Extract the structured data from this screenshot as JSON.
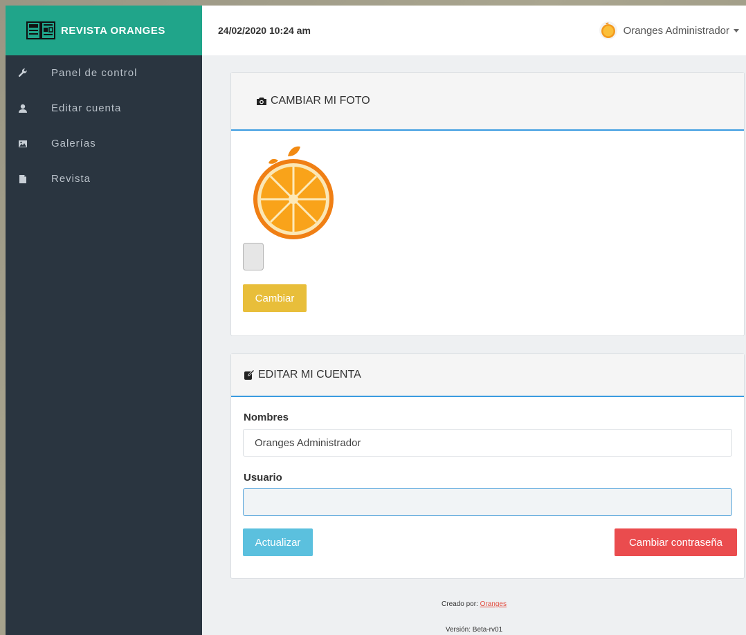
{
  "brand": {
    "title": "REVISTA ORANGES",
    "color": "#20a58a"
  },
  "header": {
    "datetime": "24/02/2020 10:24 am",
    "user_name": "Oranges Administrador"
  },
  "sidebar": {
    "items": [
      {
        "label": "Panel de control",
        "icon": "wrench-icon"
      },
      {
        "label": "Editar cuenta",
        "icon": "user-icon"
      },
      {
        "label": "Galerías",
        "icon": "image-icon"
      },
      {
        "label": "Revista",
        "icon": "file-icon"
      }
    ]
  },
  "photo_panel": {
    "title": "CAMBIAR MI FOTO",
    "icon": "camera-icon",
    "button": "Cambiar"
  },
  "account_panel": {
    "title": "EDITAR MI CUENTA",
    "icon": "edit-icon",
    "nombres_label": "Nombres",
    "nombres_value": "Oranges Administrador",
    "usuario_label": "Usuario",
    "usuario_value": "",
    "update_button": "Actualizar",
    "password_button": "Cambiar contraseña"
  },
  "footer": {
    "created_by": "Creado por:",
    "author": "Oranges",
    "version": "Versión: Beta-rv01"
  },
  "colors": {
    "sidebar": "#2a3540",
    "accent_blue": "#3a9be0",
    "yellow": "#e8be3a",
    "cyan": "#5bc0de",
    "red": "#ea4c4e"
  }
}
